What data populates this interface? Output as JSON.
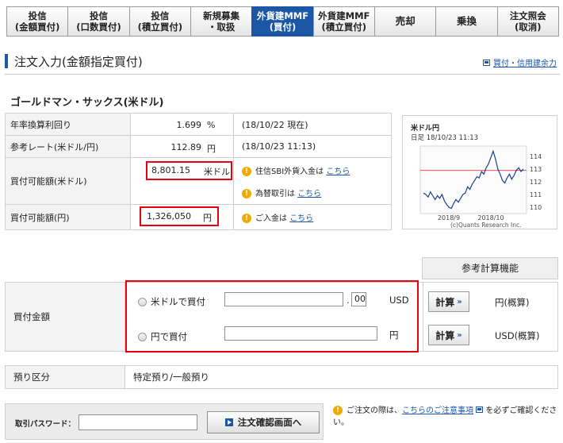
{
  "tabs": [
    {
      "line1": "投信",
      "line2": "(金額買付)",
      "active": false
    },
    {
      "line1": "投信",
      "line2": "(口数買付)",
      "active": false
    },
    {
      "line1": "投信",
      "line2": "(積立買付)",
      "active": false
    },
    {
      "line1": "新規募集",
      "line2": "・取扱",
      "active": false
    },
    {
      "line1": "外貨建MMF",
      "line2": "(買付)",
      "active": true
    },
    {
      "line1": "外貨建MMF",
      "line2": "(積立買付)",
      "active": false
    },
    {
      "line1": "売却",
      "line2": "",
      "active": false
    },
    {
      "line1": "乗換",
      "line2": "",
      "active": false
    },
    {
      "line1": "注文照会",
      "line2": "(取消)",
      "active": false
    }
  ],
  "page": {
    "title": "注文入力(金額指定買付)",
    "top_link": "買付・信用建余力",
    "company": "ゴールドマン・サックス(米ドル)"
  },
  "info": {
    "yield_label": "年率換算利回り",
    "yield_value": "1.699",
    "yield_unit": "%",
    "yield_note": "(18/10/22 現在)",
    "rate_label": "参考レート(米ドル/円)",
    "rate_value": "112.89",
    "rate_unit": "円",
    "rate_note": "(18/10/23 11:13)",
    "usd_label": "買付可能額(米ドル)",
    "usd_value": "8,801.15",
    "usd_unit": "米ドル",
    "usd_note1_text": "住信SBI外貨入金は",
    "usd_note1_link": "こちら",
    "usd_note2_text": "為替取引は",
    "usd_note2_link": "こちら",
    "jpy_label": "買付可能額(円)",
    "jpy_value": "1,326,050",
    "jpy_unit": "円",
    "jpy_note_text": "ご入金は",
    "jpy_note_link": "こちら"
  },
  "mini_chart": {
    "title": "米ドル円",
    "subtitle": "日足 18/10/23 11:13",
    "credit": "(c)Quants Research Inc.",
    "x_labels": [
      "2018/9",
      "2018/10"
    ],
    "y_ticks": [
      110,
      111,
      112,
      113,
      114
    ],
    "ylim": [
      109.5,
      114.8
    ],
    "reference_line": 112.89,
    "values": [
      111.1,
      111.0,
      110.8,
      111.2,
      110.9,
      110.6,
      110.9,
      110.7,
      111.0,
      110.5,
      110.2,
      110.0,
      109.9,
      110.3,
      110.6,
      110.4,
      110.7,
      111.0,
      111.1,
      111.6,
      111.4,
      111.8,
      112.1,
      112.4,
      112.3,
      112.8,
      112.6,
      113.1,
      113.4,
      113.9,
      114.4,
      113.8,
      113.0,
      112.6,
      112.1,
      111.9,
      112.3,
      112.6,
      112.2,
      112.5,
      112.9,
      113.1,
      112.8,
      113.0
    ],
    "line_color": "#1a3f8a",
    "ref_color": "#e05050"
  },
  "calc": {
    "label": "参考計算機能",
    "button_label": "計算",
    "button_arrow": "»",
    "jpy_approx": "円(概算)",
    "usd_approx": "USD(概算)"
  },
  "amount": {
    "label": "買付金額",
    "option_usd": "米ドルで買付",
    "option_jpy": "円で買付",
    "decimal_value": "00",
    "usd_unit": "USD",
    "jpy_unit": "円"
  },
  "deposit": {
    "label": "預り区分",
    "value": "特定預り/一般預り"
  },
  "password": {
    "label": "取引パスワード：",
    "confirm_label": "注文確認画面へ"
  },
  "note": {
    "text_before": "ご注文の際は、",
    "link": "こちらのご注意事項",
    "text_after": "を必ずご確認ください。"
  }
}
